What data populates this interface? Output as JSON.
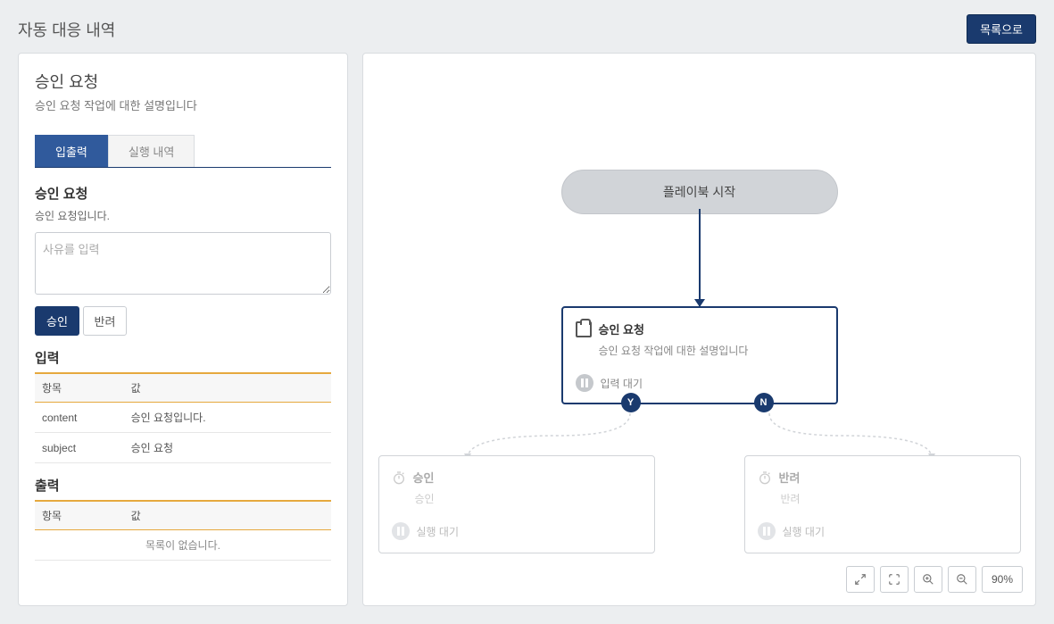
{
  "header": {
    "title": "자동 대응 내역",
    "back_button": "목록으로"
  },
  "detail": {
    "title": "승인 요청",
    "desc": "승인 요청 작업에 대한 설명입니다"
  },
  "tabs": {
    "io": "입출력",
    "history": "실행 내역"
  },
  "approval": {
    "title": "승인 요청",
    "desc": "승인 요청입니다.",
    "placeholder": "사유를 입력",
    "approve_btn": "승인",
    "reject_btn": "반려"
  },
  "input_table": {
    "title": "입력",
    "col_key": "항목",
    "col_val": "값",
    "rows": [
      {
        "key": "content",
        "val": "승인 요청입니다."
      },
      {
        "key": "subject",
        "val": "승인 요청"
      }
    ]
  },
  "output_table": {
    "title": "출력",
    "col_key": "항목",
    "col_val": "값",
    "empty": "목록이 없습니다."
  },
  "flow": {
    "start": "플레이북 시작",
    "approve_node": {
      "title": "승인 요청",
      "desc": "승인 요청 작업에 대한 설명입니다",
      "status": "입력 대기",
      "badge_y": "Y",
      "badge_n": "N"
    },
    "yes_node": {
      "title": "승인",
      "desc": "승인",
      "status": "실행 대기"
    },
    "no_node": {
      "title": "반려",
      "desc": "반려",
      "status": "실행 대기"
    }
  },
  "zoom": {
    "value": "90%"
  }
}
